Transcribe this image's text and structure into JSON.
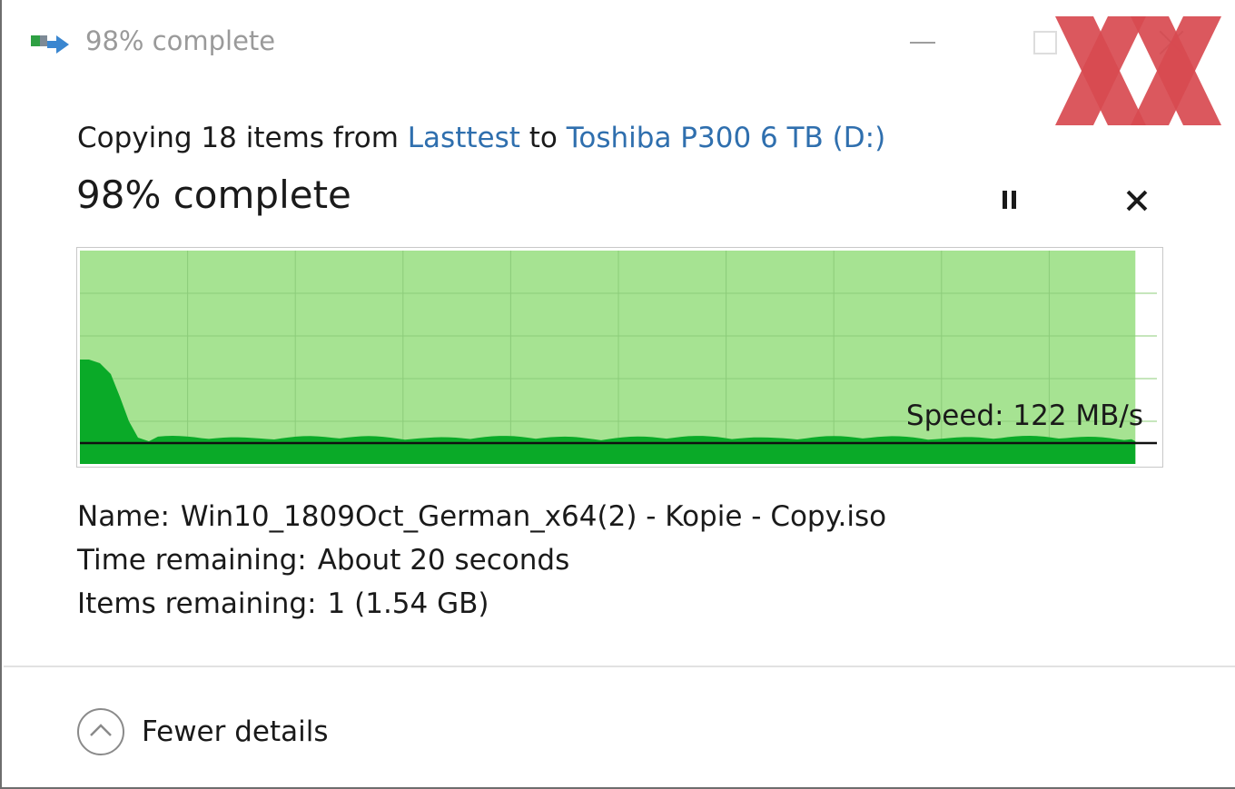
{
  "window": {
    "title": "98% complete"
  },
  "header": {
    "copy_prefix": "Copying 18 items from",
    "source": "Lasttest",
    "connector": "to",
    "destination": "Toshiba P300 6 TB (D:)",
    "progress_text": "98% complete"
  },
  "progress": {
    "percent": 98
  },
  "speed": {
    "label": "Speed: 122 MB/s",
    "value_mb_s": 122
  },
  "details": {
    "name_label": "Name:",
    "name_value": "Win10_1809Oct_German_x64(2) - Kopie - Copy.iso",
    "time_label": "Time remaining:",
    "time_value": "About 20 seconds",
    "items_label": "Items remaining:",
    "items_value": "1 (1.54 GB)"
  },
  "footer": {
    "toggle_label": "Fewer details"
  },
  "colors": {
    "graph_area": "#a6e392",
    "graph_speed": "#0aaa28",
    "graph_grid": "#8ccc7a",
    "link": "#2f6fae",
    "watermark": "#d84a50"
  },
  "icons": {
    "title": "file-copy-icon",
    "pause": "pause-icon",
    "cancel": "close-icon",
    "toggle": "chevron-up-icon",
    "watermark": "xx-logo"
  }
}
